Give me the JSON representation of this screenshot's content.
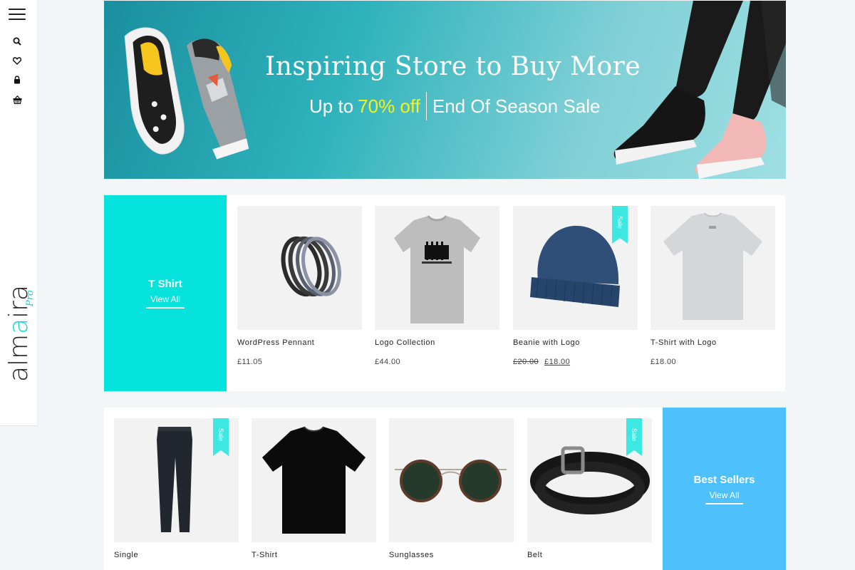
{
  "sidebar": {
    "logo_prefix": "alm",
    "logo_accent": "a",
    "logo_suffix": "ira",
    "logo_pro": "Pro",
    "icons": [
      "search-icon",
      "heart-icon",
      "lock-icon",
      "basket-icon"
    ]
  },
  "banner": {
    "title": "Inspiring Store to Buy More",
    "sub_prefix": "Up to",
    "sub_highlight": "70% off",
    "sub_suffix": "End Of Season Sale",
    "highlight_color": "#f3f21a"
  },
  "row1": {
    "category": {
      "title": "T Shirt",
      "link": "View All",
      "color": "#06e3dd"
    },
    "products": [
      {
        "name": "WordPress Pennant",
        "price": "£11.05",
        "sale": false
      },
      {
        "name": "Logo Collection",
        "price": "£44.00",
        "sale": false
      },
      {
        "name": "Beanie with Logo",
        "old_price": "£20.00",
        "price": "£18.00",
        "sale": true,
        "sale_label": "Sale"
      },
      {
        "name": "T-Shirt with Logo",
        "price": "£18.00",
        "sale": false
      }
    ]
  },
  "row2": {
    "category": {
      "title": "Best Sellers",
      "link": "View All",
      "color": "#4ec0fb"
    },
    "products": [
      {
        "name": "Single",
        "sale": true,
        "sale_label": "Sale"
      },
      {
        "name": "T-Shirt",
        "sale": false
      },
      {
        "name": "Sunglasses",
        "sale": false
      },
      {
        "name": "Belt",
        "sale": true,
        "sale_label": "Sale"
      }
    ]
  },
  "colors": {
    "accent": "#12d7d3",
    "sale_ribbon": "#3ee8e2"
  }
}
